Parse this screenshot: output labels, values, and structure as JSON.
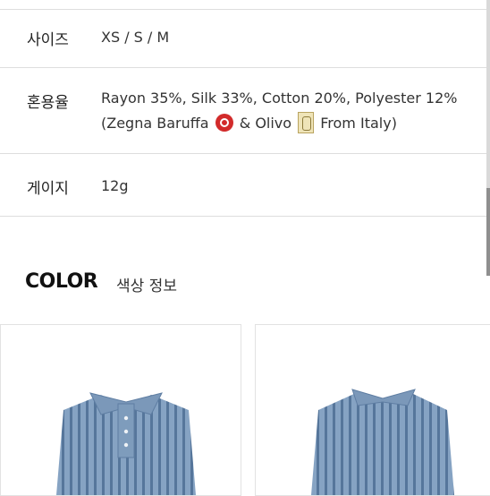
{
  "specs": {
    "size": {
      "label": "사이즈",
      "value": "XS / S / M"
    },
    "material": {
      "label": "혼용율",
      "line1": "Rayon 35%, Silk 33%, Cotton 20%, Polyester 12%",
      "line2_start": "(Zegna Baruffa",
      "line2_mid": "& Olivo",
      "line2_end": "From Italy)"
    },
    "gauge": {
      "label": "게이지",
      "value": "12g"
    }
  },
  "color_section": {
    "title": "COLOR",
    "subtitle": "색상 정보"
  },
  "colors": {
    "knit_blue": "#7e9cbc",
    "knit_stripe": "#58779a",
    "brand_red": "#d22b2b"
  }
}
